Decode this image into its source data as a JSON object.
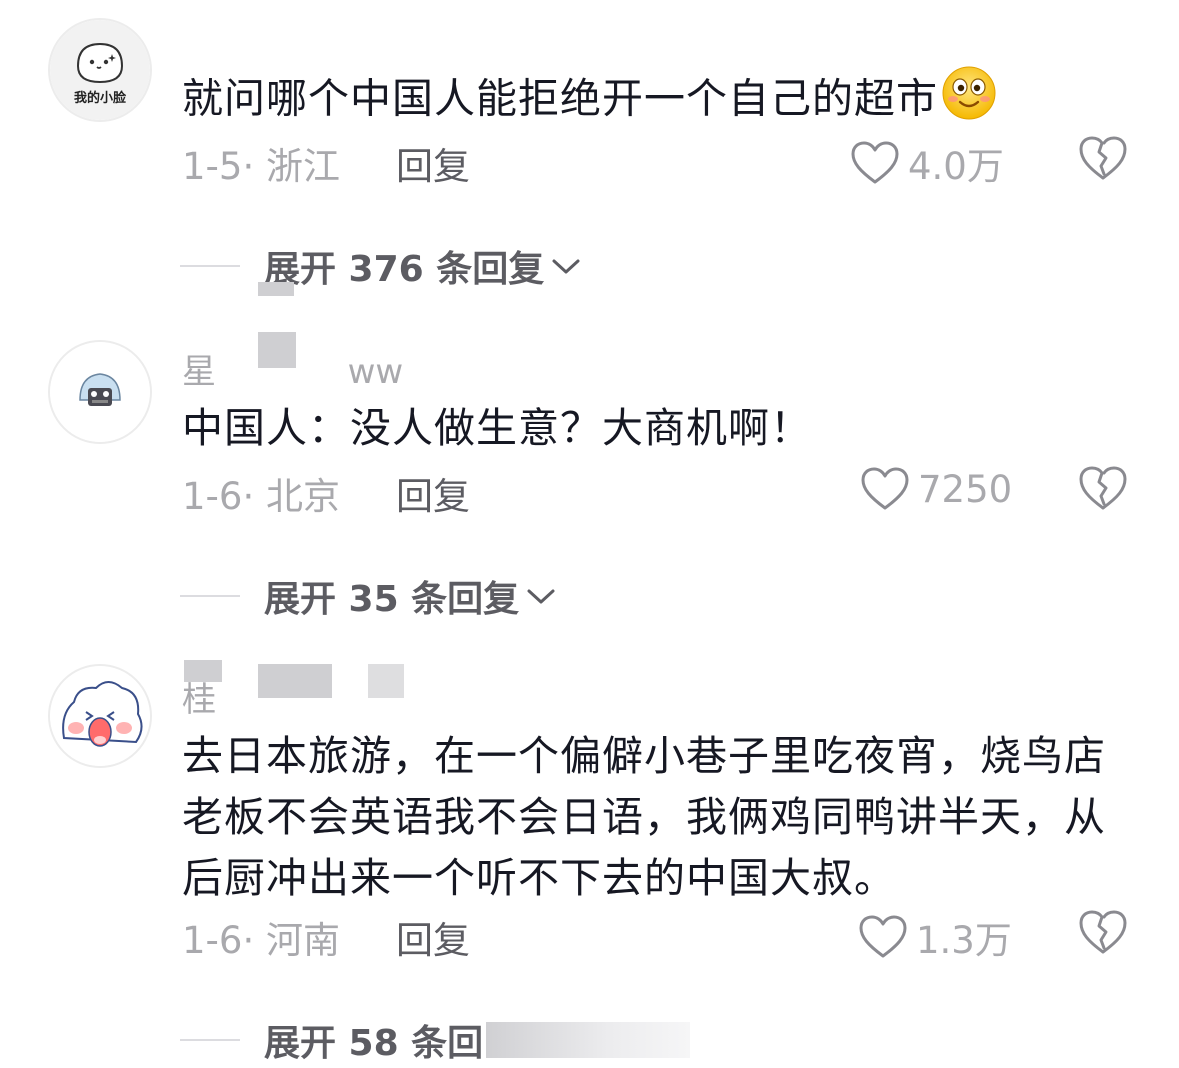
{
  "comments": [
    {
      "avatar_label": "我的小脸",
      "text": "就问哪个中国人能拒绝开一个自己的超市",
      "emoji": "smiley-emoji",
      "date": "1-5",
      "separator": "·",
      "location": "浙江",
      "reply_label": "回复",
      "likes": "4.0万",
      "expand_label": "展开 376 条回复"
    },
    {
      "username_visible": "星",
      "username_tail": "ww",
      "text": "中国人：没人做生意？大商机啊！",
      "date": "1-6",
      "separator": "·",
      "location": "北京",
      "reply_label": "回复",
      "likes": "7250",
      "expand_label": "展开 35 条回复"
    },
    {
      "username_visible": "桂",
      "text": "去日本旅游，在一个偏僻小巷子里吃夜宵，烧鸟店老板不会英语我不会日语，我俩鸡同鸭讲半天，从后厨冲出来一个听不下去的中国大叔。",
      "date": "1-6",
      "separator": "·",
      "location": "河南",
      "reply_label": "回复",
      "likes": "1.3万",
      "expand_label": "展开 58 条回"
    }
  ],
  "icons": {
    "like": "heart-outline-icon",
    "dislike": "broken-heart-icon",
    "expand": "chevron-down-icon"
  },
  "colors": {
    "text": "#161823",
    "meta": "#a9a9ad",
    "reply": "#5c5c62",
    "background": "#ffffff"
  }
}
